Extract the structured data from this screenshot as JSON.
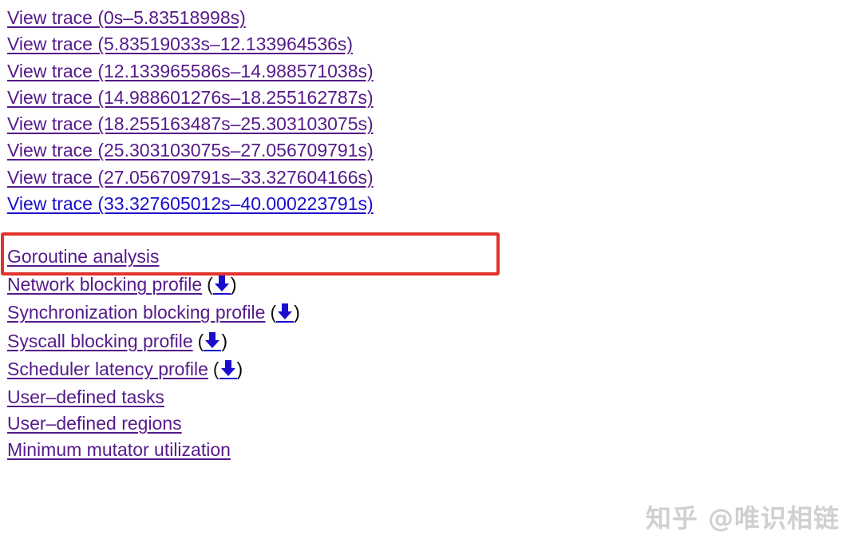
{
  "traces": [
    {
      "label": "View trace (0s–5.83518998s)",
      "visited": true
    },
    {
      "label": "View trace (5.83519033s–12.133964536s)",
      "visited": true
    },
    {
      "label": "View trace (12.133965586s–14.988571038s)",
      "visited": true
    },
    {
      "label": "View trace (14.988601276s–18.255162787s)",
      "visited": true
    },
    {
      "label": "View trace (18.255163487s–25.303103075s)",
      "visited": true
    },
    {
      "label": "View trace (25.303103075s–27.056709791s)",
      "visited": true
    },
    {
      "label": "View trace (27.056709791s–33.327604166s)",
      "visited": true
    },
    {
      "label": "View trace (33.327605012s–40.000223791s)",
      "visited": false
    }
  ],
  "analysis": {
    "goroutine": "Goroutine analysis",
    "network_blocking": "Network blocking profile",
    "sync_blocking": "Synchronization blocking profile",
    "syscall_blocking": "Syscall blocking profile",
    "scheduler_latency": "Scheduler latency profile",
    "user_tasks": "User–defined tasks",
    "user_regions": "User–defined regions",
    "mmu": "Minimum mutator utilization",
    "paren_open": "(",
    "paren_close": ")"
  },
  "download_icon": "download-arrow",
  "colors": {
    "visited_link": "#551a8b",
    "link": "#1a0dcc",
    "highlight": "#e2332c"
  },
  "watermark": "知乎 @唯识相链"
}
